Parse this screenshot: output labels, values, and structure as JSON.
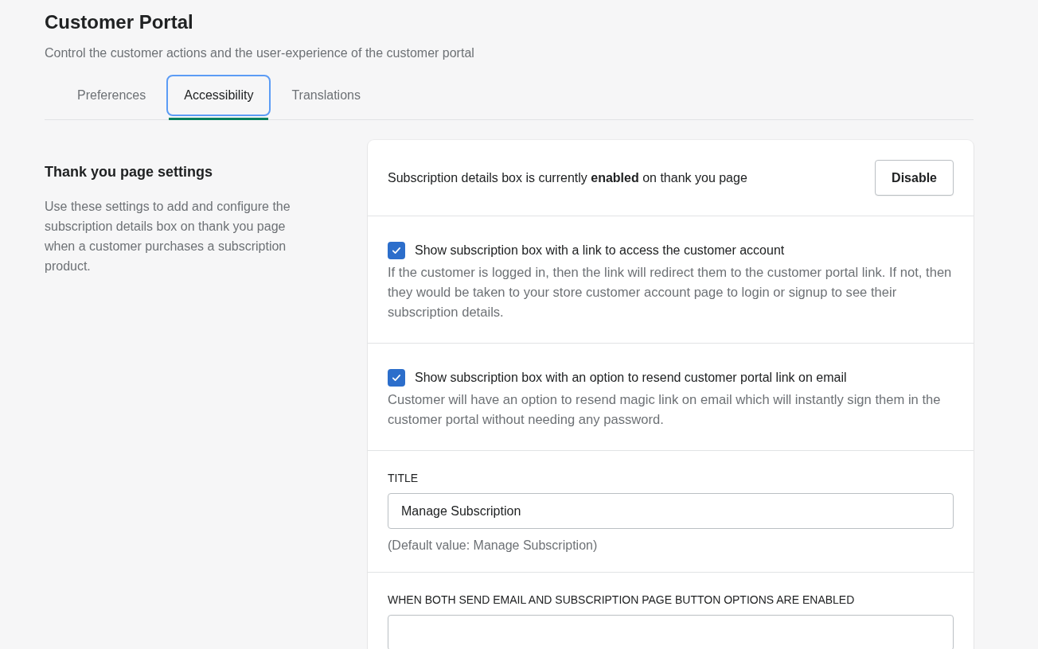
{
  "header": {
    "title": "Customer Portal",
    "subtitle": "Control the customer actions and the user-experience of the customer portal"
  },
  "tabs": [
    {
      "label": "Preferences",
      "selected": false
    },
    {
      "label": "Accessibility",
      "selected": true
    },
    {
      "label": "Translations",
      "selected": false
    }
  ],
  "section": {
    "title": "Thank you page settings",
    "description": "Use these settings to add and configure the subscription details box on thank you page when a customer purchases a subscription product."
  },
  "card": {
    "status": "Subscription details box is currently **enabled** on thank you page",
    "status_button": "Disable",
    "options": [
      {
        "label": "Show subscription box with a link to access the customer account",
        "checked": true,
        "help": "If the customer is logged in, then the link will redirect them to the customer portal link. If not, then they would be taken to your store customer account page to login or signup to see their subscription details."
      },
      {
        "label": "Show subscription box with an option to resend customer portal link on email",
        "checked": true,
        "help": "Customer will have an option to resend magic link on email which will instantly sign them in the customer portal without needing any password."
      }
    ],
    "fields": [
      {
        "label": "TITLE",
        "value": "Manage Subscription",
        "hint": "(Default value: Manage Subscription)"
      },
      {
        "label": "WHEN BOTH SEND EMAIL AND SUBSCRIPTION PAGE BUTTON OPTIONS ARE ENABLED"
      }
    ]
  }
}
